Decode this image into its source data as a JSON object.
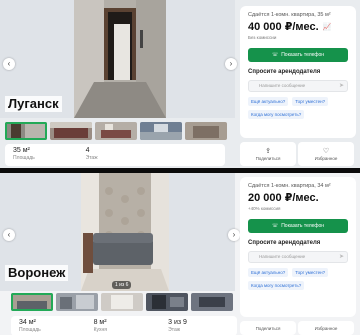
{
  "listing1": {
    "city": "Луганск",
    "photo_counter": "",
    "params": [
      {
        "value": "35 м²",
        "label": "Площадь"
      },
      {
        "value": "4",
        "label": "Этаж"
      }
    ],
    "card": {
      "title": "Сдаётся 1-комн. квартира, 35 м²",
      "price": "40 000 ₽/мес.",
      "sub": "Без комиссии",
      "phone_button": "Показать телефон",
      "ask_title": "Спросите арендодателя",
      "message_placeholder": "Напишите сообщение",
      "chips": [
        "Ещё актуально?",
        "Торг уместен?",
        "Когда могу посмотреть?"
      ]
    },
    "actions": [
      {
        "label": "Поделиться"
      },
      {
        "label": "Избранное"
      }
    ]
  },
  "listing2": {
    "city": "Воронеж",
    "photo_counter": "1 из 6",
    "params": [
      {
        "value": "34 м²",
        "label": "Площадь"
      },
      {
        "value": "8 м²",
        "label": "Кухня"
      },
      {
        "value": "3 из 9",
        "label": "Этаж"
      }
    ],
    "card": {
      "title": "Сдаётся 1-комн. квартира, 34 м²",
      "price": "20 000 ₽/мес.",
      "sub": "+40% комиссия",
      "phone_button": "Показать телефон",
      "ask_title": "Спросите арендодателя",
      "message_placeholder": "Напишите сообщение",
      "chips": [
        "Ещё актуально?",
        "Торг уместен?",
        "Когда могу посмотреть?"
      ]
    },
    "actions": [
      {
        "label": "Поделиться"
      },
      {
        "label": "Избранное"
      }
    ]
  },
  "colors": {
    "accent_green": "#15924b",
    "active_thumb": "#22a957",
    "link_blue": "#2d6fd6"
  },
  "icons": [
    "chevron-left-icon",
    "chevron-right-icon",
    "phone-icon",
    "send-icon",
    "share-icon",
    "heart-icon",
    "chart-icon"
  ]
}
